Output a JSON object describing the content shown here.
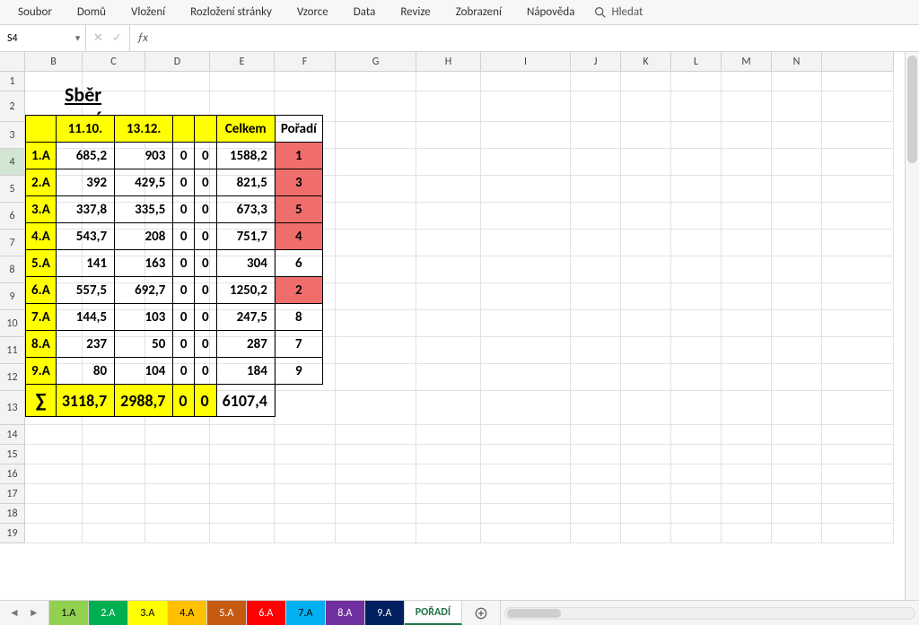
{
  "active_cell": "S4",
  "ribbon_tabs": [
    "Soubor",
    "Domů",
    "Vložení",
    "Rozložení stránky",
    "Vzorce",
    "Data",
    "Revize",
    "Zobrazení",
    "Nápověda"
  ],
  "search_label": "Hledat",
  "columns": [
    "B",
    "C",
    "D",
    "E",
    "F",
    "G",
    "H",
    "I",
    "J",
    "K",
    "L",
    "M",
    "N"
  ],
  "row_numbers": [
    "1",
    "2",
    "3",
    "4",
    "5",
    "6",
    "7",
    "8",
    "9",
    "10",
    "11",
    "12",
    "13",
    "14",
    "15",
    "16",
    "17",
    "18",
    "19"
  ],
  "title": "Sběr papíru",
  "headers": {
    "c": "11.10.",
    "d": "13.12.",
    "g": "Celkem",
    "h": "Pořadí"
  },
  "rows": [
    {
      "class": "1.A",
      "c": "685,2",
      "d": "903",
      "e": "0",
      "f": "0",
      "g": "1588,2",
      "rank": "1",
      "highlight": true
    },
    {
      "class": "2.A",
      "c": "392",
      "d": "429,5",
      "e": "0",
      "f": "0",
      "g": "821,5",
      "rank": "3",
      "highlight": true
    },
    {
      "class": "3.A",
      "c": "337,8",
      "d": "335,5",
      "e": "0",
      "f": "0",
      "g": "673,3",
      "rank": "5",
      "highlight": true
    },
    {
      "class": "4.A",
      "c": "543,7",
      "d": "208",
      "e": "0",
      "f": "0",
      "g": "751,7",
      "rank": "4",
      "highlight": true
    },
    {
      "class": "5.A",
      "c": "141",
      "d": "163",
      "e": "0",
      "f": "0",
      "g": "304",
      "rank": "6",
      "highlight": false
    },
    {
      "class": "6.A",
      "c": "557,5",
      "d": "692,7",
      "e": "0",
      "f": "0",
      "g": "1250,2",
      "rank": "2",
      "highlight": true
    },
    {
      "class": "7.A",
      "c": "144,5",
      "d": "103",
      "e": "0",
      "f": "0",
      "g": "247,5",
      "rank": "8",
      "highlight": false
    },
    {
      "class": "8.A",
      "c": "237",
      "d": "50",
      "e": "0",
      "f": "0",
      "g": "287",
      "rank": "7",
      "highlight": false
    },
    {
      "class": "9.A",
      "c": "80",
      "d": "104",
      "e": "0",
      "f": "0",
      "g": "184",
      "rank": "9",
      "highlight": false
    }
  ],
  "sum": {
    "label": "∑",
    "c": "3118,7",
    "d": "2988,7",
    "e": "0",
    "f": "0",
    "g": "6107,4"
  },
  "sheet_tabs": [
    {
      "label": "1.A",
      "color": "#92d050"
    },
    {
      "label": "2.A",
      "color": "#00b050"
    },
    {
      "label": "3.A",
      "color": "#ffff00"
    },
    {
      "label": "4.A",
      "color": "#ffc000"
    },
    {
      "label": "5.A",
      "color": "#c55a11"
    },
    {
      "label": "6.A",
      "color": "#ff0000"
    },
    {
      "label": "7.A",
      "color": "#00b0f0"
    },
    {
      "label": "8.A",
      "color": "#7030a0"
    },
    {
      "label": "9.A",
      "color": "#002060"
    }
  ],
  "active_sheet": "POŘADÍ"
}
